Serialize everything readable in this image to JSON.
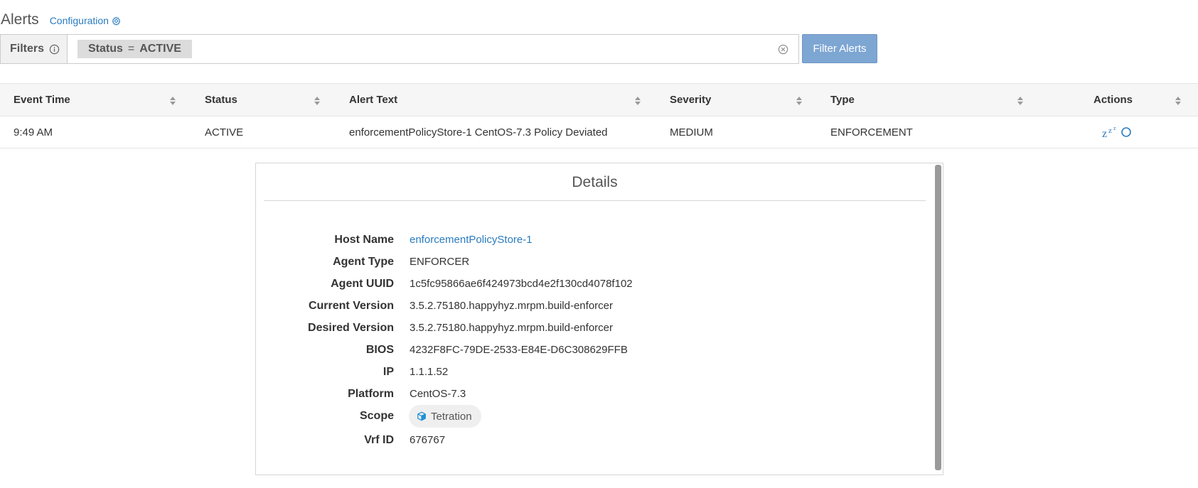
{
  "header": {
    "title": "Alerts",
    "config_label": "Configuration",
    "config_icon": "gear-icon"
  },
  "filters": {
    "label": "Filters",
    "chip": {
      "field": "Status",
      "operator": "=",
      "value": "ACTIVE"
    },
    "button_label": "Filter Alerts"
  },
  "table": {
    "columns": [
      "Event Time",
      "Status",
      "Alert Text",
      "Severity",
      "Type",
      "Actions"
    ],
    "rows": [
      {
        "event_time": "9:49 AM",
        "status": "ACTIVE",
        "alert_text": "enforcementPolicyStore-1 CentOS-7.3 Policy Deviated",
        "severity": "MEDIUM",
        "type": "ENFORCEMENT",
        "actions": [
          "snooze-icon",
          "circle-icon"
        ]
      }
    ]
  },
  "details": {
    "title": "Details",
    "fields": [
      {
        "label": "Host Name",
        "value": "enforcementPolicyStore-1"
      },
      {
        "label": "Agent Type",
        "value": "ENFORCER"
      },
      {
        "label": "Agent UUID",
        "value": "1c5fc95866ae6f424973bcd4e2f130cd4078f102"
      },
      {
        "label": "Current Version",
        "value": "3.5.2.75180.happyhyz.mrpm.build-enforcer"
      },
      {
        "label": "Desired Version",
        "value": "3.5.2.75180.happyhyz.mrpm.build-enforcer"
      },
      {
        "label": "BIOS",
        "value": "4232F8FC-79DE-2533-E84E-D6C308629FFB"
      },
      {
        "label": "IP",
        "value": "1.1.1.52"
      },
      {
        "label": "Platform",
        "value": "CentOS-7.3"
      },
      {
        "label": "Scope",
        "value": "Tetration"
      },
      {
        "label": "Vrf ID",
        "value": "676767"
      }
    ]
  },
  "colors": {
    "link": "#2a7bbf",
    "button": "#7ea6d3",
    "scope_icon": "#1e8fd6"
  }
}
